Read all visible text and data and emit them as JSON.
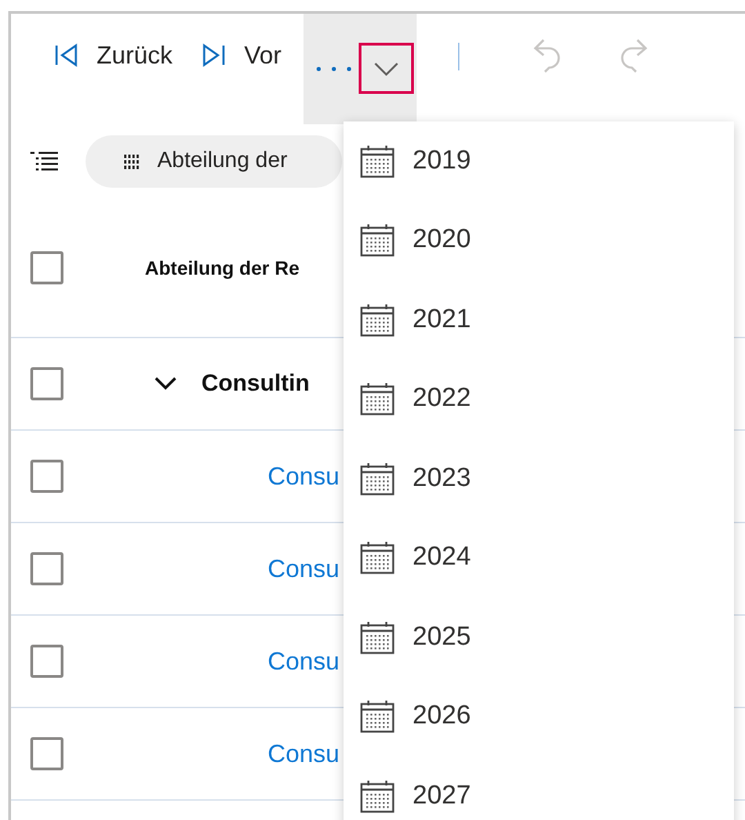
{
  "toolbar": {
    "back": {
      "label": "Zurück"
    },
    "forward": {
      "label": "Vor"
    },
    "more": {
      "expanded": true,
      "focused": true
    },
    "undo": {
      "disabled": true
    },
    "redo": {
      "disabled": true
    }
  },
  "group_chip": {
    "label": "Abteilung der"
  },
  "table": {
    "header": {
      "checked": false,
      "label": "Abteilung der Re"
    },
    "group": {
      "checked": false,
      "expanded": true,
      "label": "Consultin"
    },
    "rows": [
      {
        "checked": false,
        "label": "Consu"
      },
      {
        "checked": false,
        "label": "Consu"
      },
      {
        "checked": false,
        "label": "Consu"
      },
      {
        "checked": false,
        "label": "Consu"
      }
    ]
  },
  "menu": {
    "items": [
      {
        "label": "2019"
      },
      {
        "label": "2020"
      },
      {
        "label": "2021"
      },
      {
        "label": "2022"
      },
      {
        "label": "2023"
      },
      {
        "label": "2024"
      },
      {
        "label": "2025"
      },
      {
        "label": "2026"
      },
      {
        "label": "2027"
      }
    ]
  }
}
